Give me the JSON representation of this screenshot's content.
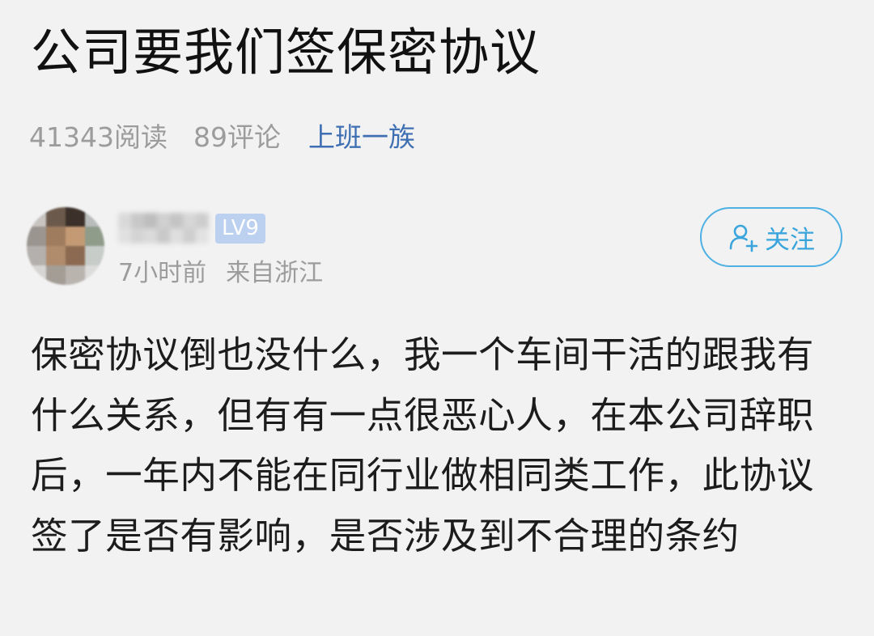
{
  "post": {
    "title": "公司要我们签保密协议",
    "views": "41343阅读",
    "comments": "89评论",
    "category": "上班一族",
    "body": "保密协议倒也没什么，我一个车间干活的跟我有什么关系，但有有一点很恶心人，在本公司辞职后，一年内不能在同行业做相同类工作，此协议签了是否有影响，是否涉及到不合理的条约"
  },
  "author": {
    "level": "LV9",
    "time": "7小时前",
    "location": "来自浙江"
  },
  "follow": {
    "label": "关注",
    "icon": "add-user-icon"
  },
  "colors": {
    "background": "#f2f2f2",
    "accent_link": "#3e6fb3",
    "follow_border": "#4fb0e3",
    "badge": "#bcd0ef"
  }
}
